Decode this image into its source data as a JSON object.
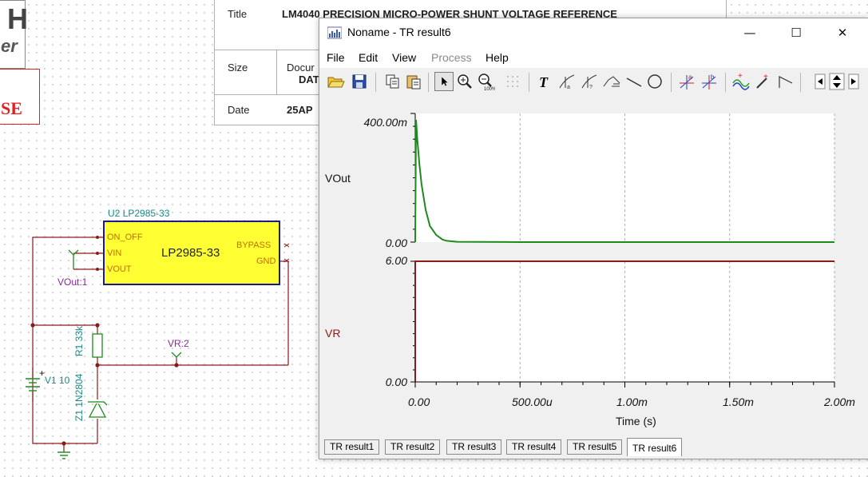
{
  "schematic": {
    "logo_partial": "H",
    "logo_sub_partial": "er",
    "license_partial": "SE",
    "component_u2_ref": "U2 LP2985-33",
    "component_u2_name": "LP2985-33",
    "u2_pins": {
      "on_off": "ON_OFF",
      "vin": "VIN",
      "vout": "VOUT",
      "bypass": "BYPASS",
      "gnd": "GND"
    },
    "probe_vout": "VOut:1",
    "probe_vr": "VR:2",
    "resistor_label": "R1 33k",
    "source_label": "V1 10",
    "zener_label": "Z1 1N2804",
    "plus_sign": "+"
  },
  "title_block": {
    "title_label": "Title",
    "title_value": "LM4040 PRECISION MICRO-POWER SHUNT VOLTAGE REFERENCE",
    "size_label": "Size",
    "doc_label": "Docur",
    "doc_value": "DAT",
    "date_label": "Date",
    "date_value": "25AP"
  },
  "window": {
    "title": "Noname - TR result6",
    "controls": {
      "minimize": "—",
      "maximize": "☐",
      "close": "✕"
    },
    "menu": [
      "File",
      "Edit",
      "View",
      "Process",
      "Help"
    ],
    "menu_disabled": [
      "Process"
    ],
    "toolbar_buttons": [
      "open-icon",
      "save-icon",
      "copy-icon",
      "paste-icon",
      "pointer-icon",
      "zoom-in-icon",
      "zoom-100-icon",
      "grid-icon",
      "text-icon",
      "cursor-a-icon",
      "cursor-b-icon",
      "trend-icon",
      "line-icon",
      "circle-icon",
      "marker-a-icon",
      "marker-b-icon",
      "curves-icon",
      "probe-icon",
      "step-icon",
      "scroll-left-icon",
      "scroll-updown-icon",
      "scroll-right-icon"
    ],
    "tabs": [
      "TR result1",
      "TR result2",
      "TR result3",
      "TR result4",
      "TR result5",
      "TR result6"
    ],
    "active_tab": "TR result6"
  },
  "chart_data": [
    {
      "type": "line",
      "series": [
        {
          "name": "VOut",
          "color": "#1e8a1e",
          "x": [
            0,
            4e-06,
            1e-05,
            2e-05,
            3e-05,
            5e-05,
            7e-05,
            0.0001,
            0.00013,
            0.00015,
            0.0002,
            0.0005,
            0.001,
            0.0015,
            0.002
          ],
          "y": [
            0,
            0.38,
            0.32,
            0.24,
            0.18,
            0.1,
            0.05,
            0.022,
            0.008,
            0.004,
            0.001,
            0.0,
            0.0,
            0.0,
            0.0
          ]
        }
      ],
      "y_tick_labels": [
        "400.00m",
        "0.00"
      ],
      "ylim": [
        0,
        0.4
      ],
      "xlim": [
        0,
        0.002
      ],
      "grid": "vertical"
    },
    {
      "type": "line",
      "series": [
        {
          "name": "VR",
          "color": "#8b1a1a",
          "x": [
            0,
            0,
            0.002
          ],
          "y": [
            0,
            6,
            6
          ]
        }
      ],
      "y_tick_labels": [
        "6.00",
        "0.00"
      ],
      "x_tick_labels": [
        "0.00",
        "500.00u",
        "1.00m",
        "1.50m",
        "2.00m"
      ],
      "x_ticks": [
        0,
        0.0005,
        0.001,
        0.0015,
        0.002
      ],
      "xlabel": "Time (s)",
      "ylim": [
        0,
        6
      ],
      "xlim": [
        0,
        0.002
      ],
      "grid": "vertical"
    }
  ]
}
